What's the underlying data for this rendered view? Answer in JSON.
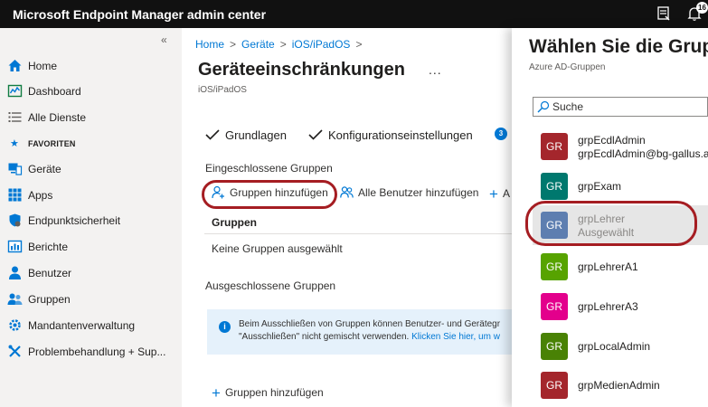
{
  "app": {
    "title": "Microsoft Endpoint Manager admin center",
    "notification_count": "16"
  },
  "sidebar": {
    "collapse_glyph": "«",
    "items": [
      {
        "label": "Home",
        "icon": "home-icon"
      },
      {
        "label": "Dashboard",
        "icon": "dashboard-icon"
      },
      {
        "label": "Alle Dienste",
        "icon": "list-icon"
      },
      {
        "label": "FAVORITEN",
        "icon": "star-icon"
      },
      {
        "label": "Geräte",
        "icon": "devices-icon"
      },
      {
        "label": "Apps",
        "icon": "apps-grid-icon"
      },
      {
        "label": "Endpunktsicherheit",
        "icon": "shield-icon"
      },
      {
        "label": "Berichte",
        "icon": "reports-icon"
      },
      {
        "label": "Benutzer",
        "icon": "user-icon"
      },
      {
        "label": "Gruppen",
        "icon": "groups-icon"
      },
      {
        "label": "Mandantenverwaltung",
        "icon": "tenant-gear-icon"
      },
      {
        "label": "Problembehandlung + Sup...",
        "icon": "troubleshoot-icon"
      }
    ]
  },
  "main": {
    "breadcrumb": [
      "Home",
      "Geräte",
      "iOS/iPadOS"
    ],
    "title": "Geräteeinschränkungen",
    "more": "...",
    "subtitle": "iOS/iPadOS",
    "steps": [
      {
        "label": "Grundlagen"
      },
      {
        "label": "Konfigurationseinstellungen"
      }
    ],
    "current_step_number": "3",
    "included_label": "Eingeschlossene Gruppen",
    "actions": {
      "add_groups": "Gruppen hinzufügen",
      "add_all_users": "Alle Benutzer hinzufügen",
      "add_more": "A"
    },
    "table_header": "Gruppen",
    "empty_row": "Keine Gruppen ausgewählt",
    "excluded_label": "Ausgeschlossene Gruppen",
    "info": {
      "line1": "Beim Ausschließen von Gruppen können Benutzer- und Gerätegr",
      "line2": "\"Ausschließen\" nicht gemischt verwenden. ",
      "link": "Klicken Sie hier, um w"
    },
    "add_groups_bottom": "Gruppen hinzufügen"
  },
  "panel": {
    "title": "Wählen Sie die Grupp",
    "subtitle": "Azure AD-Gruppen",
    "search_placeholder": "Suche",
    "groups": [
      {
        "initials": "GR",
        "name": "grpEcdlAdmin",
        "sub": "grpEcdlAdmin@bg-gallus.at",
        "color": "#a4262c",
        "selected": false
      },
      {
        "initials": "GR",
        "name": "grpExam",
        "sub": "",
        "color": "#00786e",
        "selected": false
      },
      {
        "initials": "GR",
        "name": "grpLehrer",
        "sub": "Ausgewählt",
        "color": "#5d7eb0",
        "selected": true
      },
      {
        "initials": "GR",
        "name": "grpLehrerA1",
        "sub": "",
        "color": "#57a300",
        "selected": false
      },
      {
        "initials": "GR",
        "name": "grpLehrerA3",
        "sub": "",
        "color": "#e3008c",
        "selected": false
      },
      {
        "initials": "GR",
        "name": "grpLocalAdmin",
        "sub": "",
        "color": "#498205",
        "selected": false
      },
      {
        "initials": "GR",
        "name": "grpMedienAdmin",
        "sub": "",
        "color": "#a4262c",
        "selected": false
      }
    ]
  }
}
